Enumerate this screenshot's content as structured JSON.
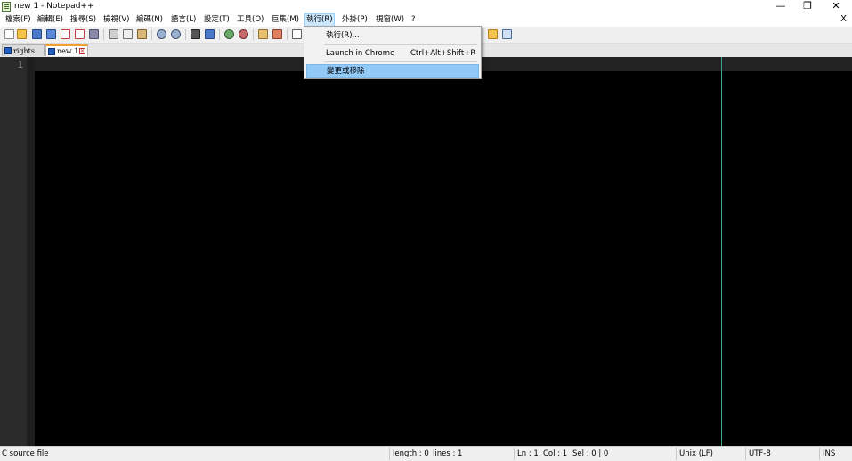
{
  "window": {
    "title": "new 1 - Notepad++",
    "controls": {
      "minimize": "—",
      "restore": "❐",
      "close": "✕"
    }
  },
  "menubar": {
    "items": [
      "檔案(F)",
      "編輯(E)",
      "搜尋(S)",
      "檢視(V)",
      "編碼(N)",
      "語言(L)",
      "設定(T)",
      "工具(O)",
      "巨集(M)",
      "執行(R)",
      "外掛(P)",
      "視窗(W)",
      "?"
    ],
    "active_item": "執行(R)",
    "close_doc": "X"
  },
  "toolbar": {
    "icons": [
      "new-file-icon",
      "open-file-icon",
      "save-icon",
      "save-all-icon",
      "close-icon",
      "close-all-icon",
      "print-icon",
      "cut-icon",
      "copy-icon",
      "paste-icon",
      "undo-icon",
      "redo-icon",
      "find-icon",
      "replace-icon",
      "zoom-in-icon",
      "zoom-out-icon",
      "sync-vertical-icon",
      "sync-horizontal-icon",
      "word-wrap-icon",
      "folder-workspace-icon",
      "monitor-icon"
    ]
  },
  "tabs": [
    {
      "label": "rights",
      "active": false
    },
    {
      "label": "new 1",
      "active": true
    }
  ],
  "editor": {
    "line_numbers": [
      "1"
    ]
  },
  "run_menu": {
    "items": [
      {
        "label": "執行(R)...",
        "shortcut": ""
      },
      {
        "label": "Launch in Chrome",
        "shortcut": "Ctrl+Alt+Shift+R"
      },
      {
        "label": "變更或移除",
        "shortcut": "",
        "highlighted": true
      }
    ]
  },
  "statusbar": {
    "file_type": "C source file",
    "length": "length : 0",
    "lines": "lines : 1",
    "ln": "Ln : 1",
    "col": "Col : 1",
    "sel": "Sel : 0 | 0",
    "eol": "Unix (LF)",
    "encoding": "UTF-8",
    "mode": "INS"
  },
  "colors": {
    "editor_bg": "#000000",
    "gutter_bg": "#2b2b2b",
    "edge_line": "#3aa38f",
    "menu_highlight": "#91c9f7",
    "active_tab_accent": "#f0a030"
  }
}
